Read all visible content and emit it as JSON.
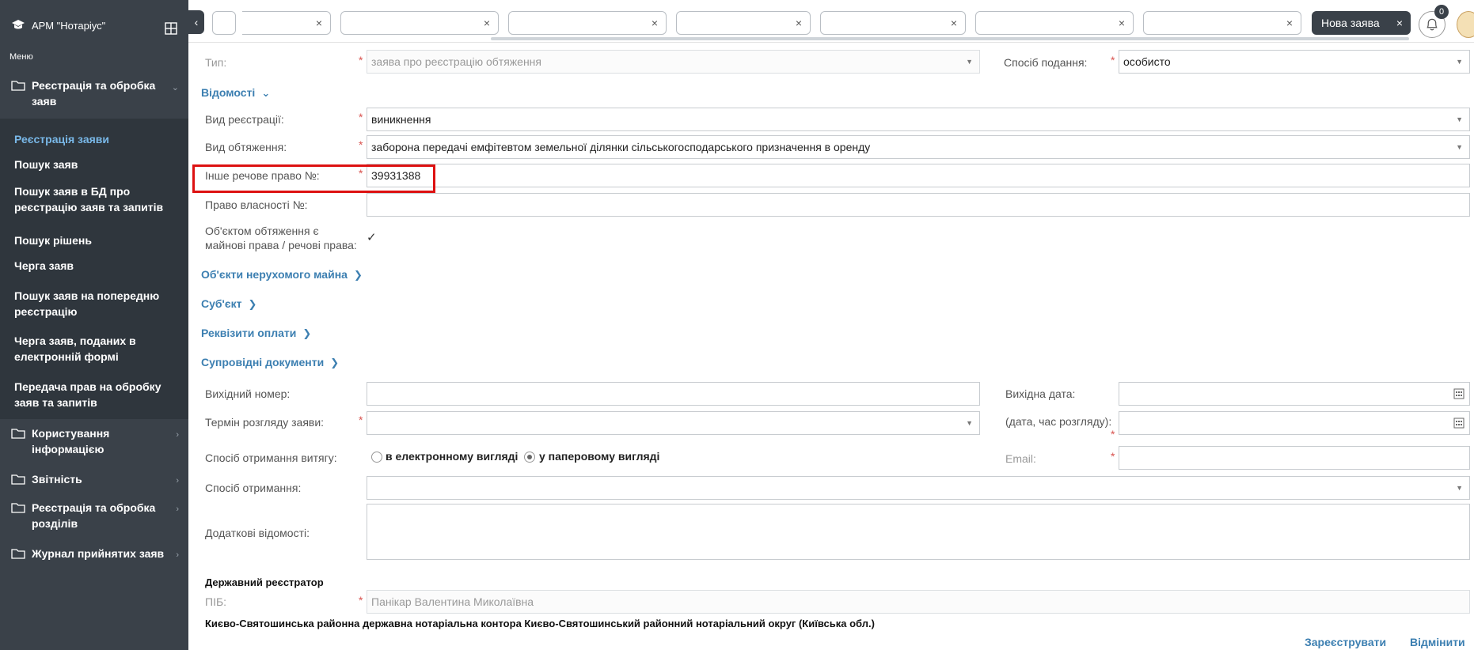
{
  "sidebar": {
    "app_title": "АРМ \"Нотаріус\"",
    "menu_label": "Меню",
    "groups": [
      {
        "label": "Реєстрація та обробка заяв"
      },
      {
        "label": "Користування інформацією"
      },
      {
        "label": "Звітність"
      },
      {
        "label": "Реєстрація та обробка розділів"
      },
      {
        "label": "Журнал прийнятих заяв"
      }
    ],
    "items": [
      {
        "label": "Реєстрація заяви"
      },
      {
        "label": "Пошук заяв"
      },
      {
        "label": "Пошук заяв в БД про реєстрацію заяв та запитів"
      },
      {
        "label": "Пошук рішень"
      },
      {
        "label": "Черга заяв"
      },
      {
        "label": "Пошук заяв на попередню реєстрацію"
      },
      {
        "label": "Черга заяв, поданих в електронній формі"
      },
      {
        "label": "Передача прав на обробку заяв та запитів"
      }
    ]
  },
  "topbar": {
    "active_tab_label": "Нова заява",
    "notification_count": "0",
    "close_glyph": "×"
  },
  "form": {
    "type_label": "Тип:",
    "type_value": "заява про реєстрацію обтяження",
    "submission_label": "Спосіб подання:",
    "submission_value": "особисто",
    "section_details": "Відомості",
    "registration_kind_label": "Вид реєстрації:",
    "registration_kind_value": "виникнення",
    "encumbrance_kind_label": "Вид обтяження:",
    "encumbrance_kind_value": "заборона передачі емфітевтом земельної ділянки сільськогосподарського призначення в оренду",
    "other_right_label": "Інше речове право №:",
    "other_right_value": "39931388",
    "ownership_label": "Право власності №:",
    "ownership_value": "",
    "object_label_line1": "Об'єктом обтяження є",
    "object_label_line2": "майнові права / речові права:",
    "object_checked": true,
    "section_real_estate": "Об'єкти нерухомого майна",
    "section_subject": "Суб'єкт",
    "section_payment": "Реквізити оплати",
    "section_documents": "Супровідні документи",
    "outgoing_number_label": "Вихідний номер:",
    "outgoing_date_label": "Вихідна дата:",
    "review_term_label": "Термін розгляду заяви:",
    "review_datetime_label": "(дата, час розгляду):",
    "extract_method_label": "Спосіб отримання витягу:",
    "extract_option_electronic": "в електронному вигляді",
    "extract_option_paper": "у паперовому вигляді",
    "extract_selected": "paper",
    "email_label": "Email:",
    "receive_method_label": "Спосіб отримання:",
    "additional_info_label": "Додаткові відомості:",
    "registrar_heading": "Державний реєстратор",
    "pib_label": "ПІБ:",
    "pib_value": "Панікар Валентина Миколаївна",
    "office_text": "Києво-Святошинська районна державна нотаріальна контора Києво-Святошинський районний нотаріальний округ (Київська обл.)"
  },
  "actions": {
    "register_label": "Зареєструвати",
    "cancel_label": "Відмінити"
  },
  "colors": {
    "sidebar_bg": "#3a4149",
    "accent": "#3c7fb1",
    "required": "#d9534f",
    "highlight": "#dd1111"
  }
}
